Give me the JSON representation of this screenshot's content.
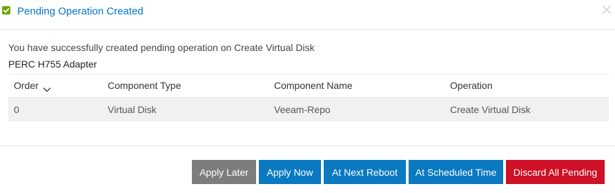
{
  "dialog": {
    "title": "Pending Operation Created",
    "message": "You have successfully created pending operation on Create Virtual Disk",
    "adapter": "PERC H755 Adapter"
  },
  "table": {
    "headers": [
      "Order",
      "Component Type",
      "Component Name",
      "Operation"
    ],
    "rows": [
      [
        "0",
        "Virtual Disk",
        "Veeam-Repo",
        "Create Virtual Disk"
      ]
    ]
  },
  "buttons": {
    "apply_later": "Apply Later",
    "apply_now": "Apply Now",
    "at_next_reboot": "At Next Reboot",
    "at_scheduled_time": "At Scheduled Time",
    "discard_all_pending": "Discard All Pending"
  },
  "colors": {
    "title_blue": "#0076ce",
    "success_green": "#6ea204",
    "button_gray": "#7d7d7d",
    "button_blue": "#0a79c1",
    "button_red": "#ce1126"
  },
  "icons": {
    "status": "check-icon",
    "close": "close-icon",
    "sort": "chevron-down-icon"
  }
}
